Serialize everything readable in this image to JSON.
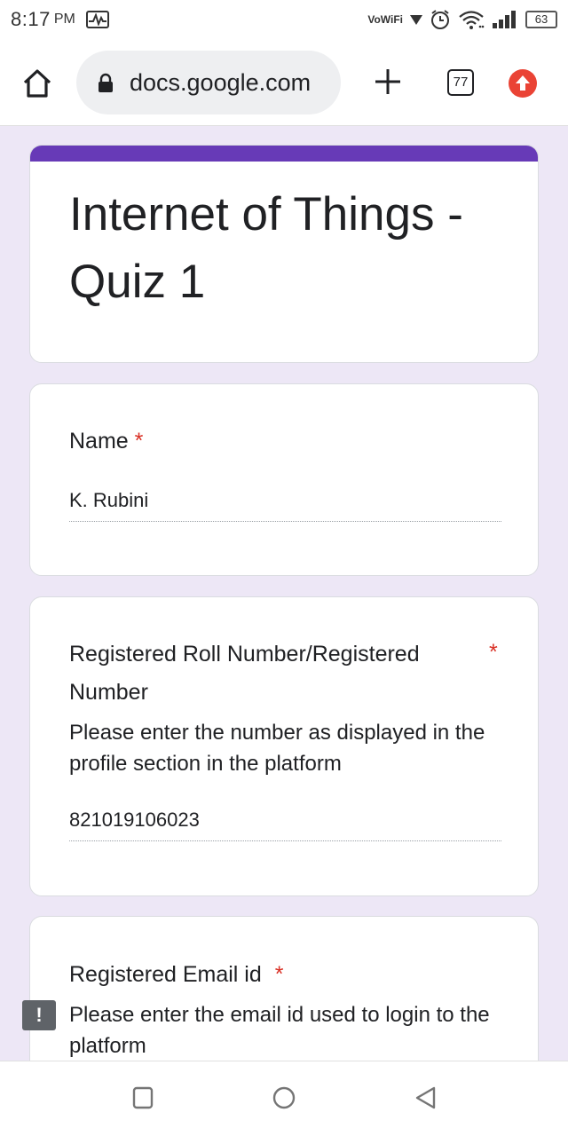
{
  "status_bar": {
    "time": "8:17",
    "ampm": "PM",
    "network_label": "VoWiFi",
    "battery": "63",
    "icons": [
      "activity-icon",
      "vowifi-icon",
      "alarm-icon",
      "wifi-icon",
      "signal-icon",
      "battery-icon"
    ]
  },
  "browser": {
    "url": "docs.google.com",
    "tab_count": "77",
    "icons": [
      "home-icon",
      "lock-icon",
      "plus-icon",
      "tab-switcher-icon",
      "update-icon"
    ]
  },
  "form": {
    "title": "Internet of Things - Quiz 1",
    "accent_color": "#673ab7",
    "background_color": "#ede7f6",
    "required_mark": "*",
    "questions": [
      {
        "label": "Name",
        "description": "",
        "answer": "K. Rubini"
      },
      {
        "label": "Registered Roll Number/Registered Number",
        "description": "Please enter the number as displayed in the profile section in the platform",
        "answer": "821019106023"
      },
      {
        "label": "Registered Email id",
        "description": "Please enter the email id used to login to the platform",
        "answer": ""
      }
    ]
  },
  "warning_badge": "!",
  "nav_bar": {
    "icons": [
      "recents-icon",
      "home-circle-icon",
      "back-icon"
    ]
  }
}
